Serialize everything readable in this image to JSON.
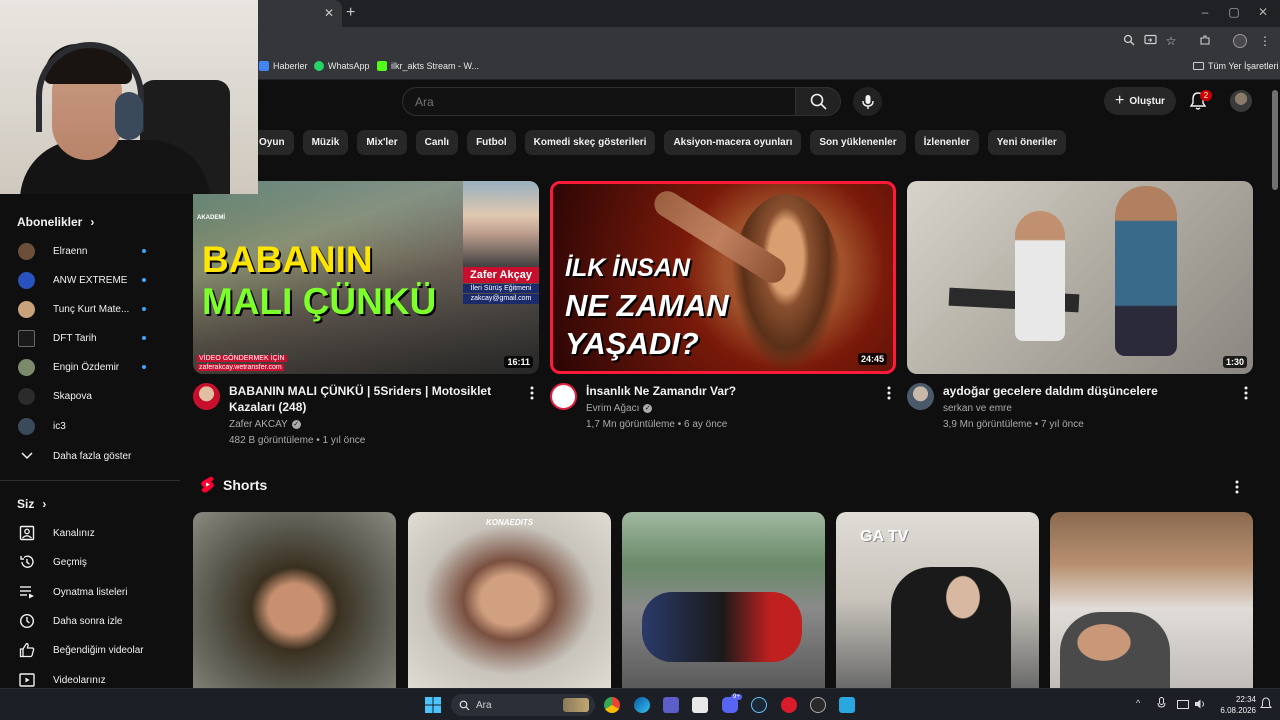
{
  "browser": {
    "bookmarks": [
      {
        "label": "Haberler",
        "color": "#4285f4"
      },
      {
        "label": "WhatsApp",
        "color": "#25d366"
      },
      {
        "label": "ilkr_akts Stream - W...",
        "color": "#53fc18"
      }
    ],
    "all_bookmarks_label": "Tüm Yer İşaretleri"
  },
  "header": {
    "search_placeholder": "Ara",
    "create_label": "Oluştur",
    "notification_count": "2"
  },
  "chips": [
    "Oyun",
    "Müzik",
    "Mix'ler",
    "Canlı",
    "Futbol",
    "Komedi skeç gösterileri",
    "Aksiyon-macera oyunları",
    "Son yüklenenler",
    "İzlenenler",
    "Yeni öneriler"
  ],
  "sidebar": {
    "subscriptions_title": "Abonelikler",
    "subscriptions": [
      {
        "label": "Elraenn",
        "color": "#6b4f3a",
        "dot": true
      },
      {
        "label": "ANW EXTREME",
        "color": "#2a52be",
        "dot": true
      },
      {
        "label": "Tunç Kurt Mate...",
        "color": "#c8a27a",
        "dot": true
      },
      {
        "label": "DFT Tarih",
        "color": "#1a1a1a",
        "dot": true
      },
      {
        "label": "Engin Özdemir",
        "color": "#7a8a6a",
        "dot": true
      },
      {
        "label": "Skapova",
        "color": "#2b2b2b",
        "dot": false
      },
      {
        "label": "ic3",
        "color": "#3a4a5a",
        "dot": false
      }
    ],
    "show_more": "Daha fazla göster",
    "you_title": "Siz",
    "you_items": [
      {
        "label": "Kanalınız",
        "icon": "channel-icon"
      },
      {
        "label": "Geçmiş",
        "icon": "history-icon"
      },
      {
        "label": "Oynatma listeleri",
        "icon": "playlist-icon"
      },
      {
        "label": "Daha sonra izle",
        "icon": "clock-icon"
      },
      {
        "label": "Beğendiğim videolar",
        "icon": "thumbs-up-icon"
      },
      {
        "label": "Videolarınız",
        "icon": "video-icon"
      }
    ]
  },
  "videos": [
    {
      "title": "BABANIN MALI ÇÜNKÜ | 5Sriders | Motosiklet Kazaları (248)",
      "channel": "Zafer AKCAY",
      "verified": true,
      "stats": "482 B görüntüleme • 1 yıl önce",
      "duration": "16:11",
      "thumb_text_1": "BABANIN",
      "thumb_text_2": "MALI ÇÜNKÜ",
      "thumb_name": "Zafer Akçay",
      "thumb_sub": "İleri Sürüş Eğitmeni",
      "thumb_email": "zakcay@gmail.com",
      "thumb_bottom": "VİDEO GÖNDERMEK İÇİN",
      "thumb_bottom_2": "zaferakcay.wetransfer.com",
      "thumb_logo": "AKADEMİ"
    },
    {
      "title": "İnsanlık Ne Zamandır Var?",
      "channel": "Evrim Ağacı",
      "verified": true,
      "stats": "1,7 Mn görüntüleme • 6 ay önce",
      "duration": "24:45",
      "thumb_text_1": "İLK İNSAN",
      "thumb_text_2": "NE ZAMAN",
      "thumb_text_3": "YAŞADI?"
    },
    {
      "title": "aydoğar gecelere daldım düşüncelere",
      "channel": "serkan ve emre",
      "verified": false,
      "stats": "3,9 Mn görüntüleme • 7 yıl önce",
      "duration": "1:30"
    }
  ],
  "shorts": {
    "title": "Shorts",
    "items": [
      {
        "overlay": ""
      },
      {
        "overlay": "KONAEDITS"
      },
      {
        "overlay": ""
      },
      {
        "overlay": "GA TV"
      },
      {
        "overlay": ""
      }
    ]
  },
  "taskbar": {
    "search_label": "Ara",
    "time": "22:34",
    "date": "6.08.2026",
    "badge_count": "9+"
  }
}
